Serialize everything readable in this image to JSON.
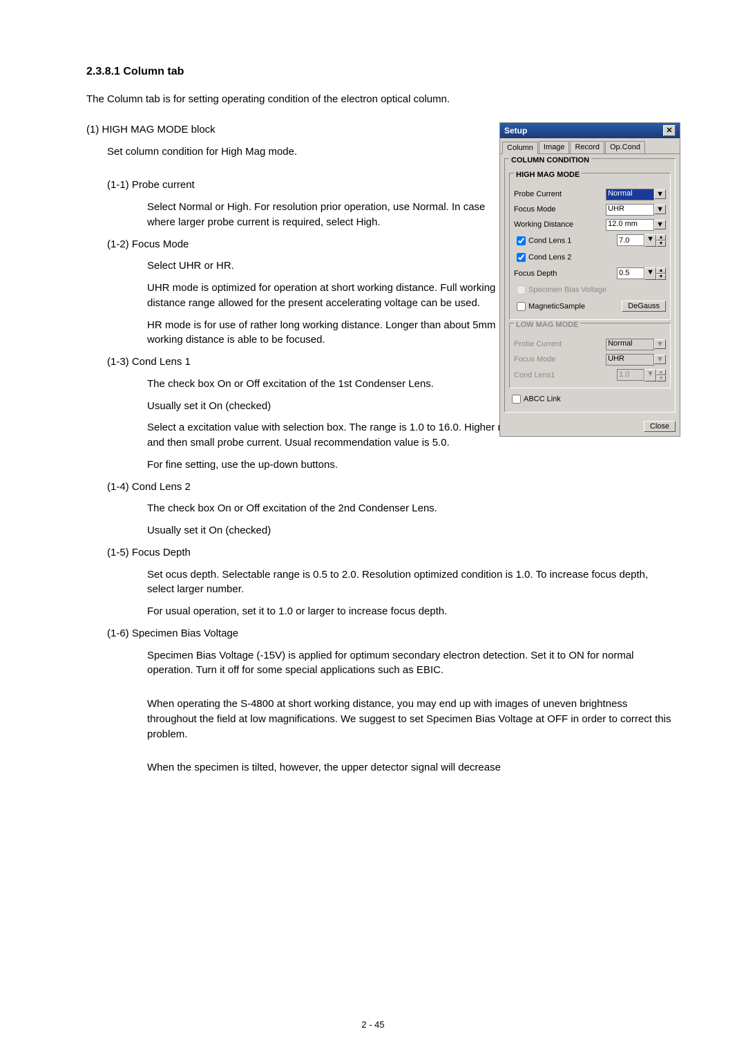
{
  "heading": "2.3.8.1 Column tab",
  "intro": "The Column tab is for setting operating condition of the electron optical column.",
  "s1_title": "(1) HIGH MAG MODE block",
  "s1_body": "Set column condition for High Mag mode.",
  "s11_title": "(1-1) Probe current",
  "s11_a": "Select Normal or High. For resolution prior operation, use Normal. In case where larger probe current is required, select High.",
  "s12_title": "(1-2) Focus Mode",
  "s12_a": "Select UHR or HR.",
  "s12_b": "UHR mode is optimized for operation at short working distance. Full working distance range allowed for the present accelerating voltage can be used.",
  "s12_c": "HR mode is for use of rather long working distance. Longer than about 5mm working distance is able to be focused.",
  "s13_title": "(1-3) Cond Lens 1",
  "s13_a": "The check box On or Off excitation of the 1st Condenser Lens.",
  "s13_b": "Usually set it On (checked)",
  "s13_c": "Select a excitation value with selection box. The range is 1.0 to 16.0. Higher number results stronger excitation and then small probe current. Usual recommendation value is 5.0.",
  "s13_d": "For fine setting, use the up-down buttons.",
  "s14_title": "(1-4) Cond Lens 2",
  "s14_a": "The check box On or Off excitation of the 2nd Condenser Lens.",
  "s14_b": "Usually set it On (checked)",
  "s15_title": "(1-5) Focus Depth",
  "s15_a": "Set ocus depth. Selectable range is 0.5 to 2.0. Resolution optimized condition is 1.0. To increase focus depth, select larger number.",
  "s15_b": "For usual operation, set it to 1.0 or larger to increase focus depth.",
  "s16_title": "(1-6) Specimen Bias Voltage",
  "s16_a": "Specimen Bias Voltage (-15V) is applied for optimum secondary electron detection. Set it to ON for normal operation.    Turn it off for some special applications such as EBIC.",
  "s16_b": "When operating the S-4800 at short working distance, you may end up with images of uneven brightness throughout the field at low magnifications.    We suggest to set Specimen Bias Voltage at OFF in order to correct this problem.",
  "s16_c": "When the specimen is tilted, however, the upper detector signal will decrease",
  "pagenum": "2 - 45",
  "dialog": {
    "title": "Setup",
    "tabs": [
      "Column",
      "Image",
      "Record",
      "Op.Cond"
    ],
    "group1": "COLUMN CONDITION",
    "group_high": "HIGH MAG MODE",
    "group_low": "LOW MAG MODE",
    "probe_current": "Probe Current",
    "probe_current_val": "Normal",
    "focus_mode": "Focus Mode",
    "focus_mode_val": "UHR",
    "working_distance": "Working Distance",
    "working_distance_val": "12.0 mm",
    "cond1": "Cond Lens 1",
    "cond1_val": "7.0",
    "cond2": "Cond Lens 2",
    "focus_depth": "Focus Depth",
    "focus_depth_val": "0.5",
    "spec_bias": "Specimen Bias Voltage",
    "mag_sample": "MagneticSample",
    "degauss": "DeGauss",
    "low_probe": "Probe Current",
    "low_probe_val": "Normal",
    "low_focus": "Focus Mode",
    "low_focus_val": "UHR",
    "low_cond1": "Cond Lens1",
    "low_cond1_val": "1.0",
    "abcc": "ABCC Link",
    "close": "Close"
  }
}
